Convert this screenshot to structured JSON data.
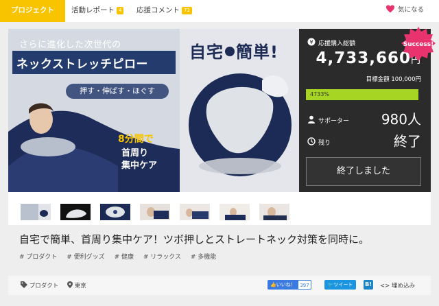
{
  "tabs": {
    "project": "プロジェクト",
    "activity": "活動レポート",
    "activity_count": "4",
    "comments": "応援コメント",
    "comments_count": "72"
  },
  "favorite_label": "気になる",
  "hero": {
    "subtitle": "さらに進化した次世代の",
    "title": "ネックストレッチピロー",
    "pills": "押す・伸ばす・ほぐす",
    "time": "8分間で",
    "line2": "首周り",
    "line3": "集中ケア",
    "right_title_a": "自宅",
    "right_title_b": "簡単!"
  },
  "panel": {
    "amount_label": "応援購入総額",
    "amount": "4,733,660",
    "amount_unit": "円",
    "goal": "目標金額 100,000円",
    "progress_text": "4733%",
    "progress_fraction": 1.0,
    "supporters_label": "サポーター",
    "supporters_value": "980人",
    "remaining_label": "残り",
    "remaining_value": "終了",
    "ended_button": "終了しました",
    "success_badge": "Success!"
  },
  "project_title": "自宅で簡単、首周り集中ケア！ツボ押しとストレートネック対策を同時に。",
  "tags": [
    "# プロダクト",
    "# 便利グッズ",
    "# 健康",
    "# リラックス",
    "# 多機能"
  ],
  "footer": {
    "category": "プロダクト",
    "location": "東京",
    "like": "いいね！",
    "like_count": "397",
    "tweet": "ツイート",
    "hatena": "B!",
    "embed": "埋め込み"
  },
  "colors": {
    "accent": "#f8c400",
    "progress": "#a6d623",
    "success": "#e8336e",
    "heart": "#e8336e"
  }
}
